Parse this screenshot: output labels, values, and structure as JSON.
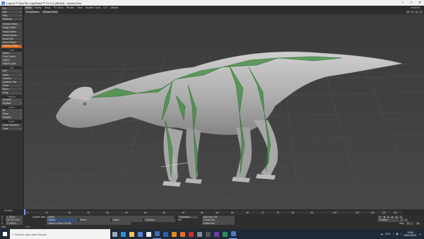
{
  "window": {
    "title": "Layout™ NewTek LightWave™ 11.6.3 (Win64) - hueso2.lws",
    "controls": [
      "–",
      "□",
      "✕"
    ]
  },
  "tabs": {
    "items": [
      "Items",
      "Modify",
      "Setup",
      "FX Tools",
      "Render",
      "View",
      "Modeler Tools",
      "LIO",
      "Utilities"
    ],
    "active_index": 0,
    "modeler_label": "Modeler"
  },
  "left_toolbar": {
    "top_items": [
      "File",
      "Edit",
      "Help",
      "Windows"
    ],
    "editors": [
      "Surface Editor",
      "Image Editor",
      "Graph Editor",
      "Virtual Studio",
      "Node Edit",
      "Scene Editor"
    ],
    "highlight": "Parent in Place",
    "load_header": "Load",
    "load_items": [
      "Scene",
      "From Scene",
      "Object",
      "Object Layer"
    ],
    "add_header": "Add",
    "add_items": [
      "Null",
      "Lights",
      "Camera",
      "Dynamic Obj",
      "Clone",
      "Mirror",
      "Array"
    ],
    "replace_header": "Replace",
    "replace_items": [
      "Rename",
      "Replace"
    ],
    "delete_header": "Delete",
    "delete_items": [
      "All",
      "Order",
      "Rotation"
    ],
    "delete2_header": "Delete",
    "delete2_items": [
      "Clear Selected",
      "Clear"
    ]
  },
  "viewport": {
    "view_mode": "Perspective",
    "shading": "Shaded Solid",
    "icons": [
      "move-icon",
      "rotate-icon",
      "zoom-icon",
      "maximize-icon"
    ]
  },
  "timeline": {
    "position_label": "Position",
    "ticks": [
      "0",
      "10",
      "15",
      "20",
      "25",
      "30",
      "35",
      "40",
      "45",
      "50",
      "55",
      "60",
      "65",
      "70",
      "75",
      "80",
      "90",
      "100",
      "110",
      "115",
      "120",
      "125"
    ],
    "current_frame": 0
  },
  "bottom": {
    "x_label": "X",
    "x_value": "1.765 m",
    "y_label": "Y",
    "y_value": "167.512 mm",
    "z_label": "Z",
    "z_value": "1.2465 m",
    "grid_label": "Grid",
    "grid_value": "1 m",
    "current_item_label": "Current Item",
    "current_item_value": "Object",
    "objects_label": "Objects",
    "bones_label": "Bones",
    "lights_label": "Lights",
    "cameras_label": "Cameras",
    "properties_label": "Properties",
    "set_label": "Set",
    "auto_key_label": "Auto Key: Off",
    "create_key_label": "Create Key",
    "delete_key_label": "Delete Key",
    "preview_label": "Preview",
    "step_label": "Step",
    "step_value": "1",
    "parent_in_place_label": "Parent in Place On/Off",
    "sel_label": "Sel",
    "sel_value": "1"
  },
  "taskbar": {
    "search_placeholder": "Escribe aquí para buscar",
    "apps": [
      {
        "name": "task-view-icon",
        "color": "#9aa7b8"
      },
      {
        "name": "edge-icon",
        "color": "#2f8fd6"
      },
      {
        "name": "explorer-icon",
        "color": "#f2c14e"
      },
      {
        "name": "store-icon",
        "color": "#5b7fd1"
      },
      {
        "name": "chrome-icon",
        "color": "#e8e8e8"
      },
      {
        "name": "lightwave-icon",
        "color": "#3d6fb5"
      },
      {
        "name": "photoshop-icon",
        "color": "#2a5ea8"
      },
      {
        "name": "illustrator-icon",
        "color": "#e08a22"
      },
      {
        "name": "firefox-icon",
        "color": "#e06a2a"
      },
      {
        "name": "acrobat-icon",
        "color": "#c9302c"
      },
      {
        "name": "settings-icon",
        "color": "#8a8a8a"
      },
      {
        "name": "zbrush-icon",
        "color": "#555555"
      },
      {
        "name": "premiere-icon",
        "color": "#6b3fa0"
      },
      {
        "name": "app-icon",
        "color": "#2e8b57"
      },
      {
        "name": "layout-icon",
        "color": "#4a7acc"
      }
    ],
    "temperature": "11°C",
    "time": "13:40",
    "date": "05/12/2021"
  },
  "colors": {
    "accent": "#c8611a",
    "bone": "#3c8a3c",
    "viewport_bg": "#404040"
  }
}
